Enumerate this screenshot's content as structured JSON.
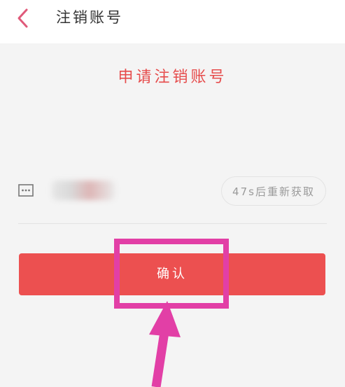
{
  "header": {
    "title": "注销账号",
    "back_icon": "chevron-left-icon",
    "accent_color": "#e05a7a"
  },
  "main": {
    "heading": "申请注销账号",
    "phone_value": "",
    "sms_icon": "message-dots-icon",
    "resend_label": "47s后重新获取",
    "confirm_label": "确认"
  },
  "colors": {
    "primary": "#ec5050",
    "annotation": "#e23fa6",
    "background": "#f4f4f4"
  }
}
